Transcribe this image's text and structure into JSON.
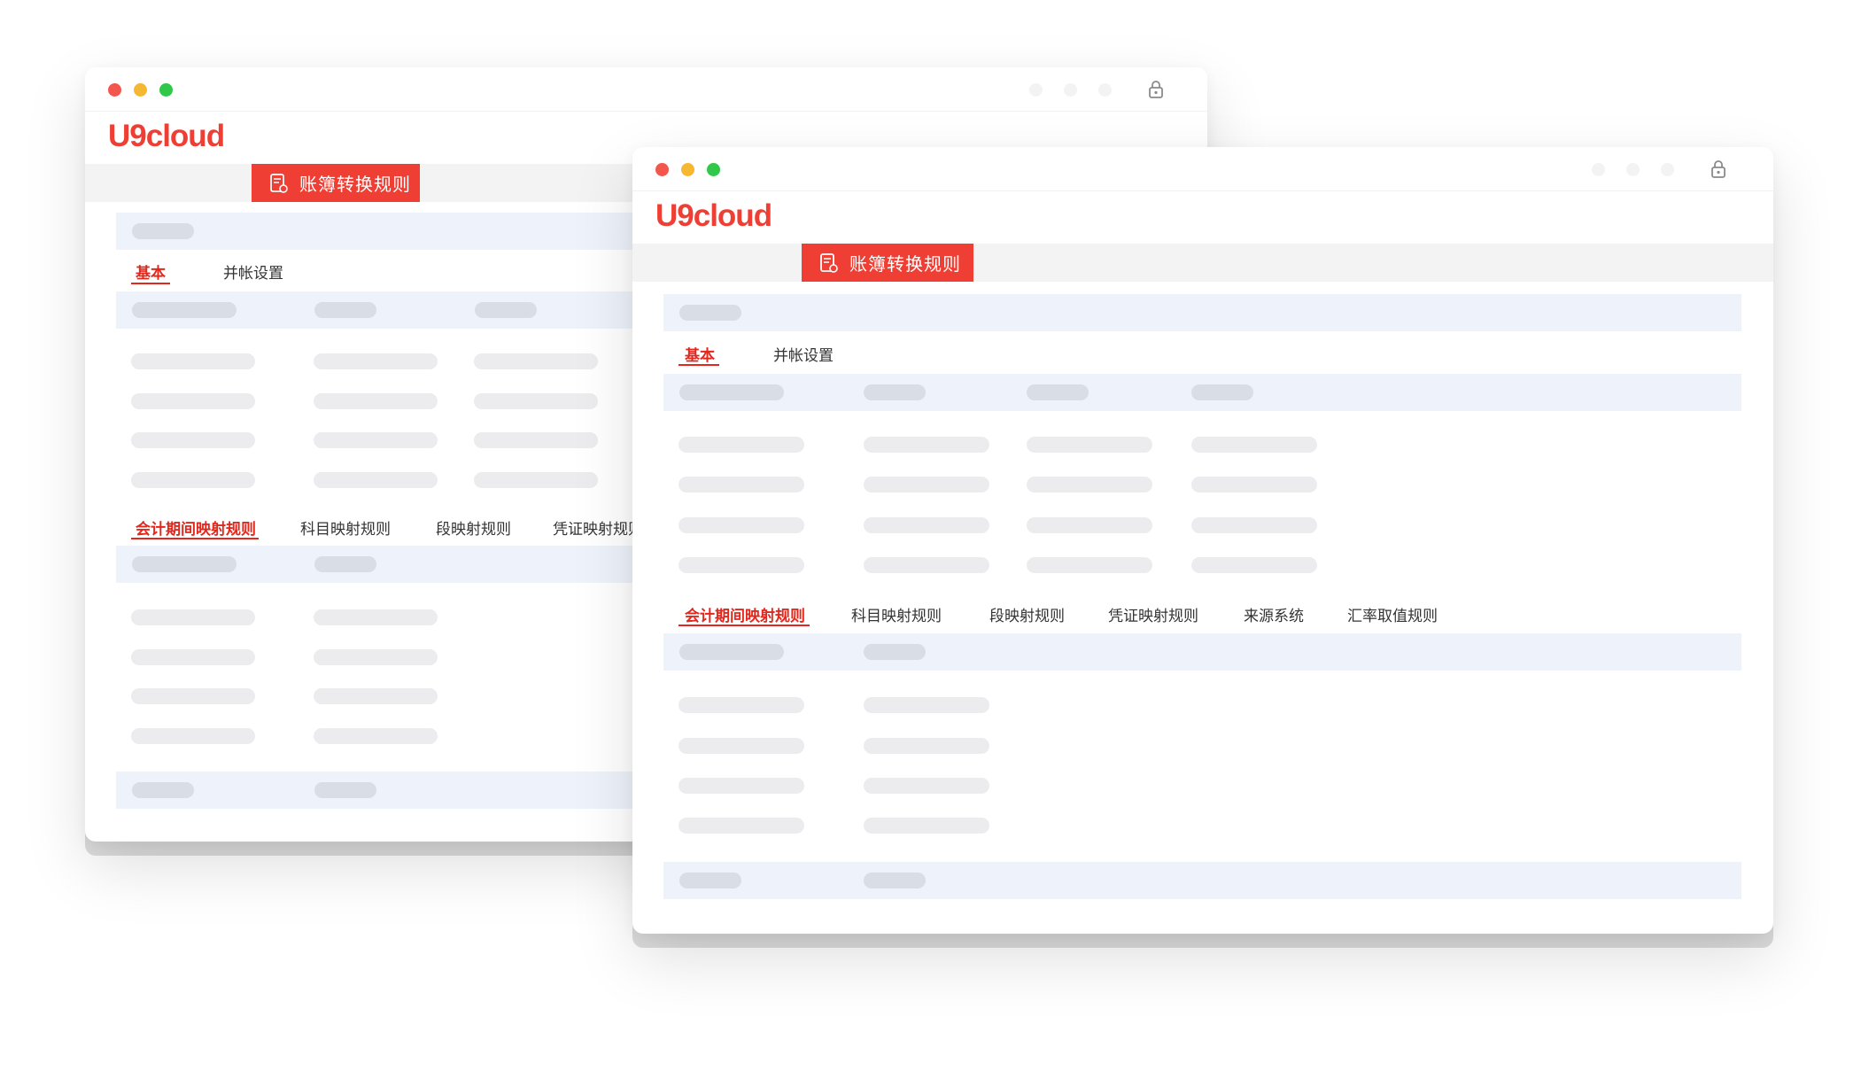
{
  "colors": {
    "brand_red": "#ef3e33",
    "active_red": "#e3271c",
    "bar_fill": "#eef3fb",
    "placeholder": "#d8dde6",
    "placeholder_light": "#ececee"
  },
  "icons": {
    "window_controls": [
      "close-dot",
      "minimize-dot",
      "zoom-dot"
    ],
    "title_right": "lock-icon",
    "nav_tab": "document-icon"
  },
  "back_window": {
    "logo": "U9cloud",
    "nav_tab_label": "账簿转换规则",
    "tabs_top": [
      "基本",
      "并帐设置"
    ],
    "active_top_tab": "基本",
    "tabs_rules": [
      "会计期间映射规则",
      "科目映射规则",
      "段映射规则",
      "凭证映射规则"
    ],
    "active_rules_tab": "会计期间映射规则"
  },
  "front_window": {
    "logo": "U9cloud",
    "nav_tab_label": "账簿转换规则",
    "tabs_top": [
      "基本",
      "并帐设置"
    ],
    "active_top_tab": "基本",
    "tabs_rules": [
      "会计期间映射规则",
      "科目映射规则",
      "段映射规则",
      "凭证映射规则",
      "来源系统",
      "汇率取值规则"
    ],
    "active_rules_tab": "会计期间映射规则"
  }
}
